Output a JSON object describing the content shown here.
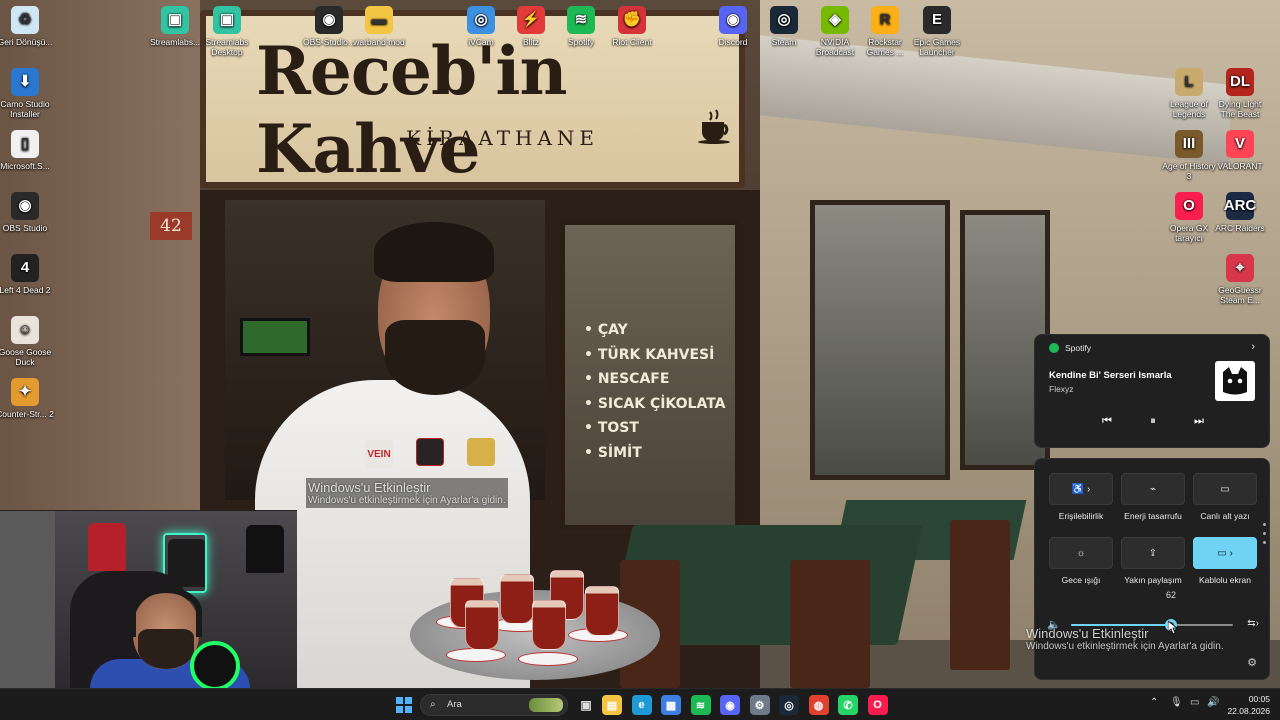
{
  "wallpaper": {
    "sign_title": "Receb'in Kahve",
    "sign_subtitle": "KİRAATHANE",
    "house_number": "42",
    "menu": [
      "• ÇAY",
      "• TÜRK KAHVESİ",
      "• NESCAFE",
      "• SICAK ÇİKOLATA",
      "• TOST",
      "• SİMİT"
    ]
  },
  "desktop_icons": [
    {
      "name": "recycle-bin",
      "label": "Geri Dönüşü...",
      "icon": "recycle-icon",
      "color": "#cfe6f5"
    },
    {
      "name": "camo-studio-installer",
      "label": "Camo Studio Installer",
      "icon": "download-icon",
      "color": "#2b78d0"
    },
    {
      "name": "microsoft-shortcut",
      "label": "Microsoft.S...",
      "icon": "file-icon",
      "color": "#f1f1f1"
    },
    {
      "name": "obs-studio",
      "label": "OBS Studio",
      "icon": "obs-icon",
      "color": "#2a2a2a"
    },
    {
      "name": "left-4-dead-2",
      "label": "Left 4 Dead 2",
      "icon": "l4d2-icon",
      "color": "#222"
    },
    {
      "name": "goose-goose-duck",
      "label": "Goose Goose Duck",
      "icon": "goose-icon",
      "color": "#e9e4da"
    },
    {
      "name": "counter-strike-2",
      "label": "Counter-Str... 2",
      "icon": "cs2-icon",
      "color": "#e39b2f"
    },
    {
      "name": "streamlabs",
      "label": "Streamlabs...",
      "icon": "streamlabs-icon",
      "color": "#31c3a2"
    },
    {
      "name": "streamlabs-desktop",
      "label": "Streamlabs Desktop",
      "icon": "streamlabs-icon",
      "color": "#31c3a2"
    },
    {
      "name": "obs-studio-top",
      "label": "OBS-Studio...",
      "icon": "obs-icon",
      "color": "#2a2a2a"
    },
    {
      "name": "warband-mod",
      "label": "warband mod",
      "icon": "folder-icon",
      "color": "#f4c542"
    },
    {
      "name": "ivcam",
      "label": "iVCam",
      "icon": "camera-icon",
      "color": "#3d8fe0"
    },
    {
      "name": "blitz",
      "label": "Blitz",
      "icon": "blitz-icon",
      "color": "#e23a3a"
    },
    {
      "name": "spotify",
      "label": "Spotify",
      "icon": "spotify-icon",
      "color": "#1db954"
    },
    {
      "name": "riot-client",
      "label": "Riot Client",
      "icon": "riot-icon",
      "color": "#d6323a"
    },
    {
      "name": "discord",
      "label": "Discord",
      "icon": "discord-icon",
      "color": "#5865f2"
    },
    {
      "name": "steam",
      "label": "Steam",
      "icon": "steam-icon",
      "color": "#1b2838"
    },
    {
      "name": "nvidia-broadcast",
      "label": "NVIDIA Broadcast",
      "icon": "nvidia-icon",
      "color": "#76b900"
    },
    {
      "name": "rockstar-games",
      "label": "Rockstar Games ...",
      "icon": "rockstar-icon",
      "color": "#fcaf17"
    },
    {
      "name": "epic-games",
      "label": "Epic Games Launcher",
      "icon": "epic-icon",
      "color": "#2a2a2a"
    },
    {
      "name": "league-of-legends",
      "label": "League of Legends",
      "icon": "lol-icon",
      "color": "#c8aa6e"
    },
    {
      "name": "dying-light",
      "label": "Dying Light The Beast",
      "icon": "dying-light-icon",
      "color": "#b3261e"
    },
    {
      "name": "age-of-history",
      "label": "Age of History 3",
      "icon": "aoh-icon",
      "color": "#7a5a2a"
    },
    {
      "name": "valorant",
      "label": "VALORANT",
      "icon": "valorant-icon",
      "color": "#fd4556"
    },
    {
      "name": "opera-gx",
      "label": "Opera GX tarayıcı",
      "icon": "opera-icon",
      "color": "#fa1e4e"
    },
    {
      "name": "arc-raiders",
      "label": "ARC Raiders",
      "icon": "arc-icon",
      "color": "#1c2a44"
    },
    {
      "name": "geoguessr",
      "label": "GeoGuessr Steam E...",
      "icon": "geoguessr-icon",
      "color": "#d8364b"
    }
  ],
  "watermark": {
    "title": "Windows'u Etkinleştir",
    "subtitle": "Windows'u etkinleştirmek için Ayarlar'a gidin."
  },
  "spotify": {
    "app_name": "Spotify",
    "track": "Kendine Bi' Serseri Ismarla",
    "artist": "Flexyz"
  },
  "quick_settings": {
    "tiles": [
      {
        "label": "Erişilebilirlik",
        "icon": "accessibility-icon",
        "glyph": "♿ ›",
        "active": false
      },
      {
        "label": "Enerji tasarrufu",
        "icon": "battery-saver-icon",
        "glyph": "⌁",
        "active": false
      },
      {
        "label": "Canlı alt yazı",
        "icon": "captions-icon",
        "glyph": "▭",
        "active": false
      },
      {
        "label": "Gece ışığı",
        "icon": "night-light-icon",
        "glyph": "☼",
        "active": false
      },
      {
        "label": "Yakın paylaşım",
        "icon": "nearby-share-icon",
        "glyph": "⇪",
        "active": false
      },
      {
        "label": "Kablolu ekran",
        "icon": "cast-icon",
        "glyph": "▭ ›",
        "active": true
      }
    ],
    "volume": 62,
    "volume_label": "62"
  },
  "taskbar": {
    "search_placeholder": "Ara",
    "apps": [
      {
        "name": "file-explorer",
        "icon": "file-explorer-icon",
        "glyph": "▤",
        "color": "#f4c542"
      },
      {
        "name": "edge",
        "icon": "edge-icon",
        "glyph": "e",
        "color": "#1f9ad6"
      },
      {
        "name": "store",
        "icon": "store-icon",
        "glyph": "▦",
        "color": "#3d7ee0"
      },
      {
        "name": "spotify",
        "icon": "spotify-icon",
        "glyph": "≋",
        "color": "#1db954"
      },
      {
        "name": "discord",
        "icon": "discord-icon",
        "glyph": "◉",
        "color": "#5865f2"
      },
      {
        "name": "settings",
        "icon": "settings-icon",
        "glyph": "⚙",
        "color": "#6c7a89"
      },
      {
        "name": "steam",
        "icon": "steam-icon",
        "glyph": "◎",
        "color": "#1b2838"
      },
      {
        "name": "chrome",
        "icon": "chrome-icon",
        "glyph": "◍",
        "color": "#e0412f"
      },
      {
        "name": "whatsapp",
        "icon": "whatsapp-icon",
        "glyph": "✆",
        "color": "#25d366"
      },
      {
        "name": "opera-gx",
        "icon": "opera-icon",
        "glyph": "O",
        "color": "#fa1e4e"
      }
    ],
    "time": "00:05",
    "date": "22.08.2026"
  }
}
